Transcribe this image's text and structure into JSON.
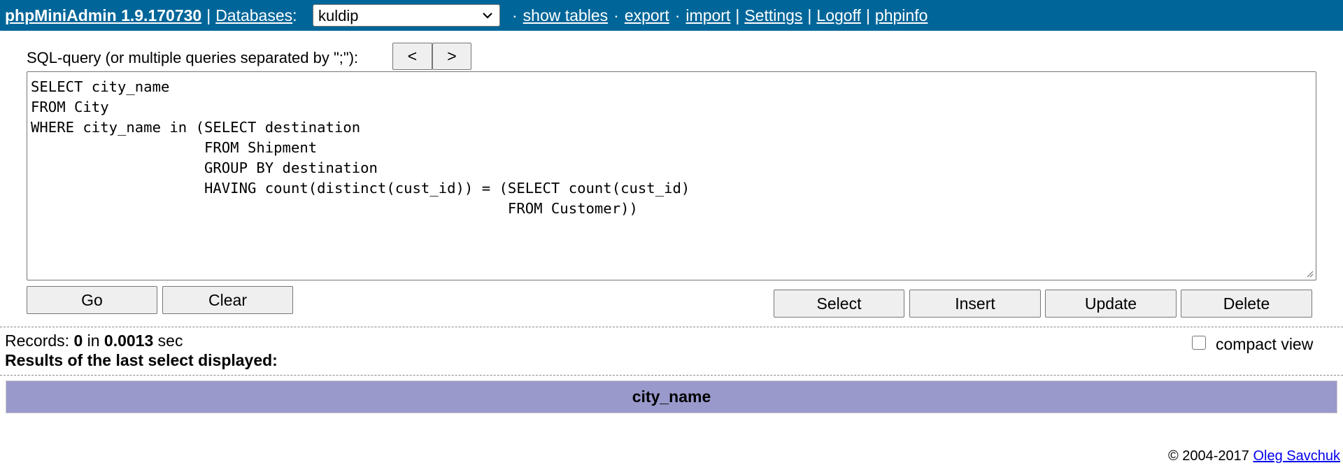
{
  "header": {
    "app_title": "phpMiniAdmin 1.9.170730",
    "databases_label": "Databases",
    "database_selected": "kuldip",
    "links": {
      "show_tables": "show tables",
      "export": "export",
      "import": "import",
      "settings": "Settings",
      "logoff": "Logoff",
      "phpinfo": "phpinfo"
    },
    "colors": {
      "bar": "#006699",
      "text": "#ffffff"
    }
  },
  "query": {
    "label": "SQL-query (or multiple queries separated by \";\"):",
    "prev_label": "<",
    "next_label": ">",
    "text": "SELECT city_name\nFROM City\nWHERE city_name in (SELECT destination\n                    FROM Shipment\n                    GROUP BY destination\n                    HAVING count(distinct(cust_id)) = (SELECT count(cust_id)\n                                                       FROM Customer))",
    "go_label": "Go",
    "clear_label": "Clear",
    "select_label": "Select",
    "insert_label": "Insert",
    "update_label": "Update",
    "delete_label": "Delete"
  },
  "results": {
    "records_label": "Records:",
    "records_count": "0",
    "in_label": "in",
    "time": "0.0013",
    "sec_label": "sec",
    "last_select_label": "Results of the last select displayed:",
    "compact_view_label": "compact view",
    "compact_view_checked": false,
    "columns": [
      "city_name"
    ],
    "header_color": "#9999cc"
  },
  "footer": {
    "copyright": "© 2004-2017",
    "author": "Oleg Savchuk"
  }
}
